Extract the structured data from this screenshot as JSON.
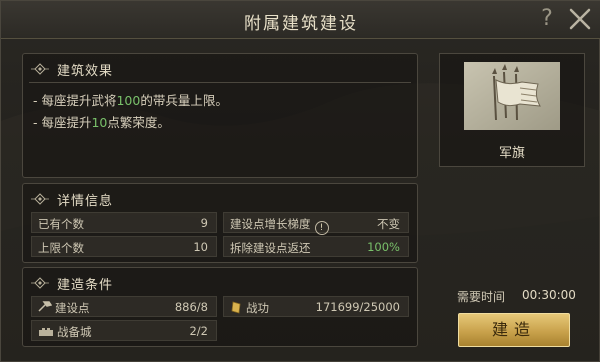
{
  "window": {
    "title": "附属建筑建设",
    "help_label": "?"
  },
  "effects": {
    "title": "建筑效果",
    "line1": {
      "prefix": "- 每座提升武将",
      "value": "100",
      "suffix": "的带兵量上限。"
    },
    "line2": {
      "prefix": "- 每座提升",
      "value": "10",
      "suffix": "点繁荣度。"
    }
  },
  "details": {
    "title": "详情信息",
    "owned_label": "已有个数",
    "owned_value": "9",
    "limit_label": "上限个数",
    "limit_value": "10",
    "growth_label": "建设点增长梯度",
    "growth_info": "!",
    "growth_value": "不变",
    "refund_label": "拆除建设点返还",
    "refund_value": "100%"
  },
  "conditions": {
    "title": "建造条件",
    "points_label": "建设点",
    "points_value": "886/8",
    "merit_label": "战功",
    "merit_value": "171699/25000",
    "city_label": "战备城",
    "city_value": "2/2"
  },
  "building": {
    "name": "军旗"
  },
  "time": {
    "label": "需要时间",
    "value": "00:30:00"
  },
  "build_button": {
    "label": "建造"
  }
}
